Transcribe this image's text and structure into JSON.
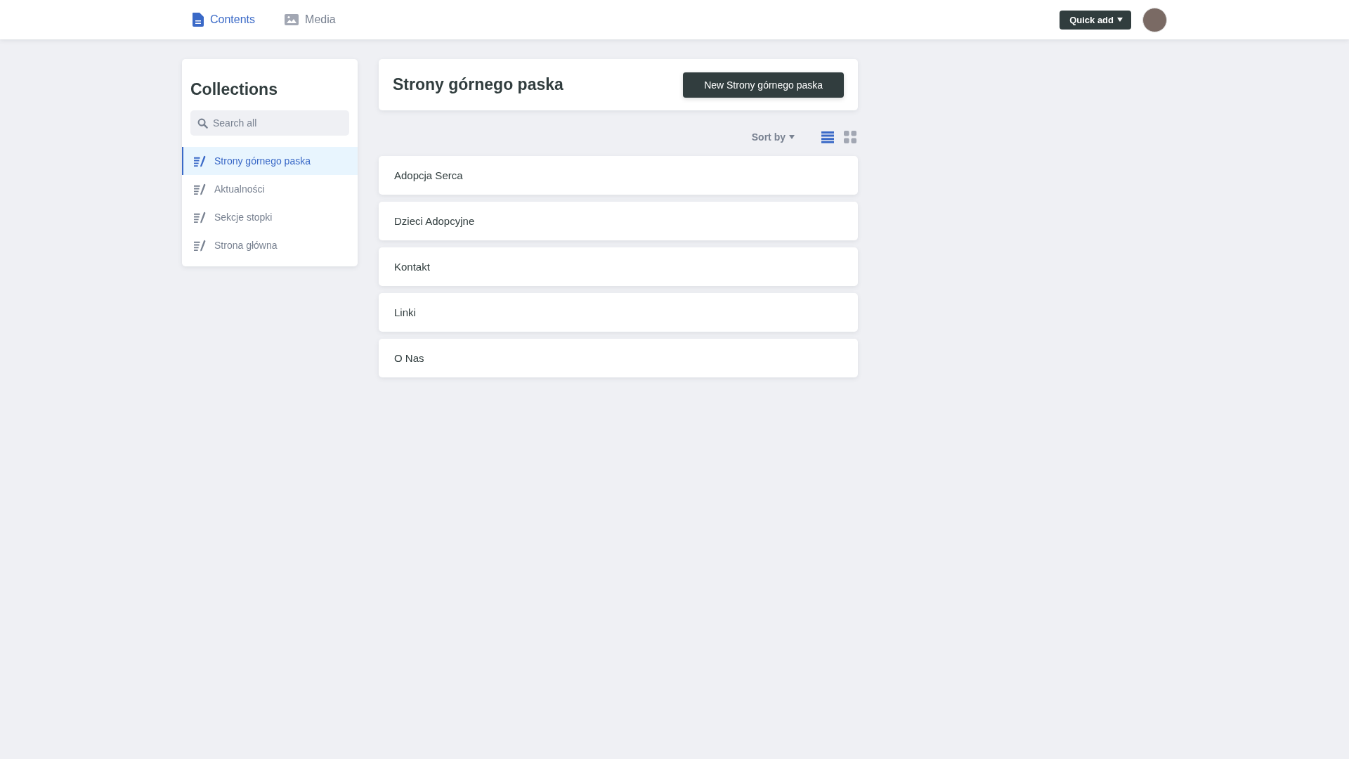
{
  "nav": {
    "tabs": [
      {
        "label": "Contents",
        "kind": "document",
        "selected": true
      },
      {
        "label": "Media",
        "kind": "image",
        "selected": false
      }
    ],
    "quick_add": "Quick add"
  },
  "sidebar": {
    "title": "Collections",
    "search": {
      "placeholder": "Search all"
    },
    "items": [
      {
        "label": "Strony górnego paska",
        "selected": true
      },
      {
        "label": "Aktualności",
        "selected": false
      },
      {
        "label": "Sekcje stopki",
        "selected": false
      },
      {
        "label": "Strona główna",
        "selected": false
      }
    ]
  },
  "main": {
    "title": "Strony górnego paska",
    "new_button": "New Strony górnego paska",
    "sort_label": "Sort by",
    "views": [
      {
        "kind": "list",
        "selected": true
      },
      {
        "kind": "grid",
        "selected": false
      }
    ],
    "entries": [
      "Adopcja Serca",
      "Dzieci Adopcyjne",
      "Kontakt",
      "Linki",
      "O Nas"
    ]
  }
}
